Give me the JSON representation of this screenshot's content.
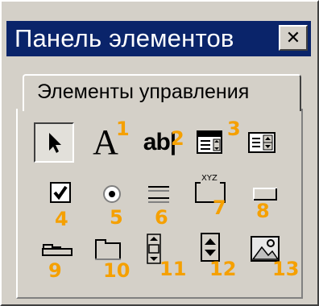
{
  "window": {
    "title": "Панель элементов",
    "close_glyph": "✕"
  },
  "tab": {
    "label": "Элементы управления"
  },
  "tools": [
    {
      "icon": "pointer-icon",
      "glyph_text": "",
      "number": ""
    },
    {
      "icon": "label-icon",
      "glyph_text": "A",
      "number": "1"
    },
    {
      "icon": "textbox-icon",
      "glyph_text": "ab|",
      "number": "2"
    },
    {
      "icon": "combobox-icon",
      "glyph_text": "",
      "number": "3"
    },
    {
      "icon": "listbox-icon",
      "glyph_text": "",
      "number": ""
    },
    {
      "icon": "checkbox-icon",
      "glyph_text": "",
      "number": "4"
    },
    {
      "icon": "option-button-icon",
      "glyph_text": "",
      "number": "5"
    },
    {
      "icon": "toggle-button-icon",
      "glyph_text": "",
      "number": "6"
    },
    {
      "icon": "frame-icon",
      "glyph_text": "XYZ",
      "number": "7"
    },
    {
      "icon": "command-button-icon",
      "glyph_text": "",
      "number": "8"
    },
    {
      "icon": "tabstrip-icon",
      "glyph_text": "",
      "number": "9"
    },
    {
      "icon": "multipage-icon",
      "glyph_text": "",
      "number": "10"
    },
    {
      "icon": "scrollbar-icon",
      "glyph_text": "",
      "number": "11"
    },
    {
      "icon": "spinbutton-icon",
      "glyph_text": "",
      "number": "12"
    },
    {
      "icon": "image-icon",
      "glyph_text": "",
      "number": "13"
    }
  ],
  "colors": {
    "title_bar": "#0a246a",
    "face": "#d4d0c8",
    "annotation": "#f5a000"
  }
}
